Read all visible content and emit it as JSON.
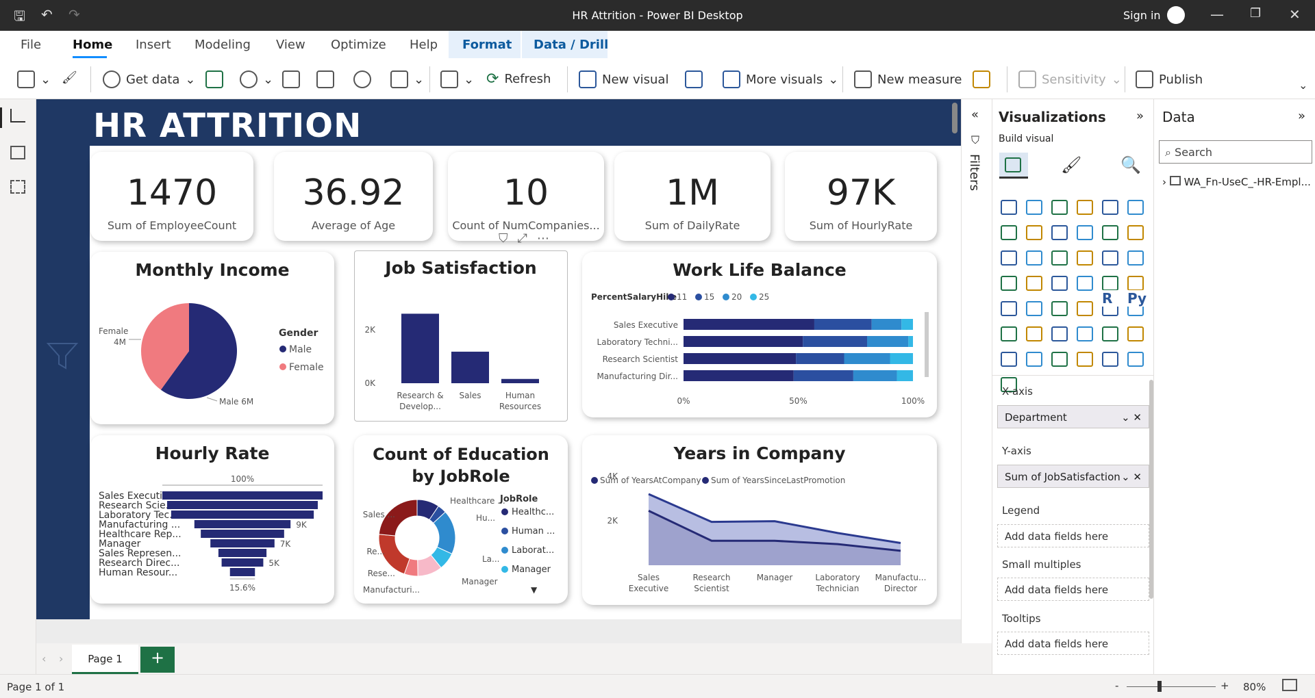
{
  "window": {
    "title": "HR Attrition - Power BI Desktop",
    "sign_in": "Sign in"
  },
  "menu": [
    "File",
    "Home",
    "Insert",
    "Modeling",
    "View",
    "Optimize",
    "Help",
    "Format",
    "Data / Drill"
  ],
  "ribbon": {
    "get_data": "Get data",
    "refresh": "Refresh",
    "new_visual": "New visual",
    "more_visuals": "More visuals",
    "new_measure": "New measure",
    "sensitivity": "Sensitivity",
    "publish": "Publish"
  },
  "report": {
    "title": "HR ATTRITION"
  },
  "kpis": [
    {
      "value": "1470",
      "label": "Sum of EmployeeCount"
    },
    {
      "value": "36.92",
      "label": "Average of Age"
    },
    {
      "value": "10",
      "label": "Count of NumCompanies..."
    },
    {
      "value": "1M",
      "label": "Sum of DailyRate"
    },
    {
      "value": "97K",
      "label": "Sum of HourlyRate"
    }
  ],
  "charts": {
    "monthly_income": {
      "title": "Monthly Income",
      "legend_title": "Gender",
      "legend": [
        "Male",
        "Female"
      ],
      "labels": [
        "Female\n4M",
        "Male 6M"
      ],
      "female_label": "Female",
      "female_value": "4M",
      "male_label": "Male 6M",
      "colors": [
        "#252a75",
        "#f07a7f"
      ],
      "values": [
        6,
        4
      ]
    },
    "job_satisfaction": {
      "title": "Job Satisfaction",
      "yticks": [
        "2K",
        "0K"
      ],
      "categories": [
        "Research & Develop...",
        "Sales",
        "Human Resources"
      ],
      "cat_lines": [
        [
          "Research &",
          "Develop..."
        ],
        [
          "Sales"
        ],
        [
          "Human",
          "Resources"
        ]
      ],
      "values": [
        2600,
        1180,
        160
      ],
      "color": "#252a75"
    },
    "work_life": {
      "title": "Work Life Balance",
      "legend_title": "PercentSalaryHike",
      "legend": [
        "11",
        "15",
        "20",
        "25"
      ],
      "colors": [
        "#252a75",
        "#2b4fa0",
        "#2f8bce",
        "#33b8e6"
      ],
      "rows": [
        "Sales Executive",
        "Laboratory Techni...",
        "Research Scientist",
        "Manufacturing Dir..."
      ],
      "values": [
        [
          57,
          25,
          13,
          5
        ],
        [
          52,
          28,
          18,
          2
        ],
        [
          49,
          21,
          20,
          10
        ],
        [
          48,
          26,
          19,
          7
        ]
      ],
      "xticks": [
        "0%",
        "50%",
        "100%"
      ]
    },
    "hourly_rate": {
      "title": "Hourly Rate",
      "top_label": "100%",
      "bottom_label": "15.6%",
      "rows": [
        "Sales Executive",
        "Research Scie...",
        "Laboratory Tec...",
        "Manufacturing ...",
        "Healthcare Rep...",
        "Manager",
        "Sales Represen...",
        "Research Direc...",
        "Human Resour..."
      ],
      "values": [
        100,
        94,
        89,
        60,
        52,
        40,
        30,
        26,
        15.6
      ],
      "value_labels": [
        "",
        "",
        "",
        "9K",
        "",
        "7K",
        "",
        "5K",
        ""
      ],
      "color": "#252a75"
    },
    "education": {
      "title": "Count of Education by JobRole",
      "legend_title": "JobRole",
      "legend": [
        "Healthc...",
        "Human ...",
        "Laborat...",
        "Manager"
      ],
      "legend_colors": [
        "#252a75",
        "#2b4fa0",
        "#2f8bce",
        "#33b8e6"
      ],
      "slice_labels": [
        "Healthcare ...",
        "Hu...",
        "La...",
        "Manager",
        "Manufacturi...",
        "Rese...",
        "Re...",
        "Sales ..."
      ],
      "values": [
        131,
        52,
        259,
        102,
        145,
        80,
        292,
        326
      ],
      "colors": [
        "#252a75",
        "#2b4fa0",
        "#2f8bce",
        "#33b8e6",
        "#f7b9c8",
        "#f07a7f",
        "#c0392b",
        "#8b1a1a"
      ]
    },
    "years": {
      "title": "Years in Company",
      "legend": [
        "Sum of YearsAtCompany",
        "Sum of YearsSinceLastPromotion"
      ],
      "categories": [
        "Sales Executive",
        "Research Scientist",
        "Manager",
        "Laboratory Technician",
        "Manufactu... Director"
      ],
      "cat_lines": [
        [
          "Sales",
          "Executive"
        ],
        [
          "Research",
          "Scientist"
        ],
        [
          "Manager"
        ],
        [
          "Laboratory",
          "Technician"
        ],
        [
          "Manufactu...",
          "Director"
        ]
      ],
      "yticks": [
        "4K",
        "2K"
      ],
      "series1": [
        3200,
        1950,
        1980,
        1450,
        1000
      ],
      "series2": [
        2450,
        1100,
        1100,
        950,
        650
      ]
    }
  },
  "filters": "Filters",
  "visualizations": {
    "title": "Visualizations",
    "build": "Build visual",
    "xaxis": "X-axis",
    "xfield": "Department",
    "yaxis": "Y-axis",
    "yfield": "Sum of JobSatisfaction",
    "legend": "Legend",
    "small": "Small multiples",
    "tooltips": "Tooltips",
    "add": "Add data fields here",
    "r": "R",
    "py": "Py"
  },
  "data_pane": {
    "title": "Data",
    "search_placeholder": "Search",
    "table": "WA_Fn-UseC_-HR-Empl..."
  },
  "pages": {
    "tab": "Page 1",
    "add": "+"
  },
  "status": {
    "page": "Page 1 of 1",
    "zoom": "80%"
  }
}
